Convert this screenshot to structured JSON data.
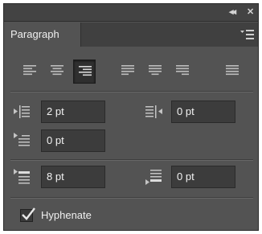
{
  "window": {
    "collapse_symbol": "◂◂",
    "close_symbol": "✕"
  },
  "panel": {
    "tab_label": "Paragraph"
  },
  "alignment": {
    "buttons": [
      {
        "name": "align-left",
        "selected": false
      },
      {
        "name": "align-center",
        "selected": false
      },
      {
        "name": "align-right",
        "selected": true
      },
      {
        "name": "justify-last-left",
        "selected": false
      },
      {
        "name": "justify-last-center",
        "selected": false
      },
      {
        "name": "justify-last-right",
        "selected": false
      },
      {
        "name": "justify-all",
        "selected": false
      }
    ]
  },
  "indents": {
    "left_indent": "2 pt",
    "right_indent": "0 pt",
    "first_line_indent": "0 pt"
  },
  "spacing": {
    "space_before": "8 pt",
    "space_after": "0 pt"
  },
  "hyphenate": {
    "label": "Hyphenate",
    "checked": true
  },
  "colors": {
    "panel_bg": "#535353",
    "field_bg": "#3c3c3c",
    "text": "#e6e6e6"
  }
}
